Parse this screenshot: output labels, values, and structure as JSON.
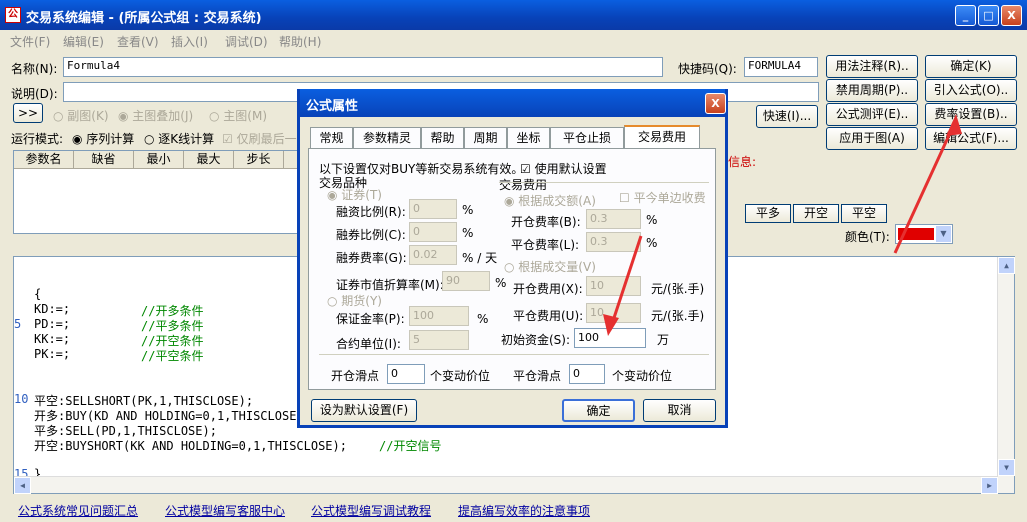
{
  "window": {
    "title": "交易系统编辑 - (所属公式组 : 交易系统)",
    "min": "_",
    "max": "□",
    "close": "X"
  },
  "menu": [
    "文件(F)",
    "编辑(E)",
    "查看(V)",
    "插入(I)",
    "调试(D)",
    "帮助(H)"
  ],
  "name_label": "名称(N):",
  "name_value": "Formula4",
  "shortcut_label": "快捷码(Q):",
  "shortcut_value": "FORMULA4",
  "desc_label": "说明(D):",
  "toolbar": {
    "expand": ">>",
    "sub_chart": "副图(K)",
    "main_overlay": "主图叠加(J)",
    "main_chart": "主图(M)",
    "quick": "快速(I)..."
  },
  "run_mode": {
    "label": "运行模式:",
    "seq": "序列计算",
    "per_k": "逐K线计算",
    "last_only": "仅刷最后一"
  },
  "right_buttons": {
    "usage": "用法注释(R)..",
    "ok": "确定(K)",
    "period": "禁用周期(P)..",
    "import": "引入公式(O)..",
    "test": "公式测评(E)..",
    "fee": "费率设置(B)..",
    "apply": "应用于图(A)",
    "edit": "编辑公式(F)..."
  },
  "params_headers": [
    "参数名",
    "缺省",
    "最小",
    "最大",
    "步长"
  ],
  "signals": [
    "平多",
    "开空",
    "平空"
  ],
  "color_label": "颜色(T):",
  "color_value": "#e00000",
  "error_text": "信息:",
  "code": {
    "lines": [
      {
        "n": "",
        "text": "{"
      },
      {
        "n": "",
        "text": "KD:=;",
        "comment": "//开多条件"
      },
      {
        "n": "5",
        "text": "PD:=;",
        "comment": "//平多条件"
      },
      {
        "n": "",
        "text": "KK:=;",
        "comment": "//开空条件"
      },
      {
        "n": "",
        "text": "PK:=;",
        "comment": "//平空条件"
      },
      {
        "n": "",
        "text": ""
      },
      {
        "n": "",
        "text": ""
      },
      {
        "n": "10",
        "text": "平空:SELLSHORT(PK,1,THISCLOSE);"
      },
      {
        "n": "",
        "text": "开多:BUY(KD AND HOLDING=0,1,THISCLOSE)"
      },
      {
        "n": "",
        "text": "平多:SELL(PD,1,THISCLOSE);"
      },
      {
        "n": "",
        "text": "开空:BUYSHORT(KK AND HOLDING=0,1,THISCLOSE);",
        "comment": "//开空信号"
      },
      {
        "n": "",
        "text": ""
      },
      {
        "n": "15",
        "text": "}"
      }
    ]
  },
  "links": [
    "公式系统常见问题汇总",
    "公式模型编写客服中心",
    "公式模型编写调试教程",
    "提高编写效率的注意事项"
  ],
  "dialog": {
    "title": "公式属性",
    "close": "X",
    "tabs": [
      "常规",
      "参数精灵",
      "帮助",
      "周期",
      "坐标",
      "平仓止损",
      "交易费用"
    ],
    "note": "以下设置仅对BUY等新交易系统有效。",
    "use_default": "使用默认设置",
    "variety_title": "交易品种",
    "stock": "证券(T)",
    "margin_ratio_label": "融资比例(R):",
    "margin_ratio": "0",
    "short_ratio_label": "融券比例(C):",
    "short_ratio": "0",
    "short_fee_label": "融券费率(G):",
    "short_fee": "0.02",
    "short_fee_unit": "% / 天",
    "mv_label": "证券市值折算率(M):",
    "mv": "90",
    "futures": "期货(Y)",
    "deposit_label": "保证金率(P):",
    "deposit": "100",
    "contract_label": "合约单位(I):",
    "contract": "5",
    "fee_title": "交易费用",
    "by_amount": "根据成交额(A)",
    "today_one": "平今单边收费",
    "open_rate_label": "开仓费率(B):",
    "open_rate": "0.3",
    "close_rate_label": "平仓费率(L):",
    "close_rate": "0.3",
    "by_volume": "根据成交量(V)",
    "open_fee_label": "开仓费用(X):",
    "open_fee": "10",
    "open_fee_unit": "元/(张.手)",
    "close_fee_label": "平仓费用(U):",
    "close_fee": "10",
    "close_fee_unit": "元/(张.手)",
    "capital_label": "初始资金(S):",
    "capital": "100",
    "capital_unit": "万",
    "open_slip_label": "开仓滑点",
    "open_slip": "0",
    "open_slip_unit": "个变动价位",
    "close_slip_label": "平仓滑点",
    "close_slip": "0",
    "close_slip_unit": "个变动价位",
    "set_default": "设为默认设置(F)",
    "ok": "确定",
    "cancel": "取消"
  }
}
